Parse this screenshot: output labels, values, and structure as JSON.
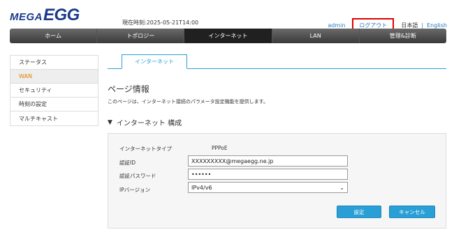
{
  "header": {
    "logo_mega": "MEGA",
    "logo_egg": "EGG",
    "current_time": "現在時刻:2025-05-21T14:00",
    "user": "admin",
    "logout": "ログアウト",
    "lang_ja": "日本語",
    "lang_sep": "|",
    "lang_en": "English"
  },
  "nav": {
    "items": [
      "ホーム",
      "トポロジー",
      "インターネット",
      "LAN",
      "管理&診断"
    ],
    "active_index": 2
  },
  "sidebar": {
    "items": [
      "ステータス",
      "WAN",
      "セキュリティ",
      "時刻の設定",
      "マルチキャスト"
    ],
    "active_index": 1
  },
  "tab": {
    "label": "インターネット"
  },
  "page": {
    "title": "ページ情報",
    "description": "このページは、インターネット接続のパラメータ設定機能を提供します。"
  },
  "section": {
    "title": "インターネット 構成"
  },
  "form": {
    "type_label": "インターネットタイプ",
    "type_value": "PPPoE",
    "auth_id_label": "認証ID",
    "auth_id_value": "XXXXXXXXX@megaegg.ne.jp",
    "auth_pw_label": "認証パスワード",
    "auth_pw_value": "••••••",
    "ip_version_label": "IPバージョン",
    "ip_version_value": "IPv4/v6"
  },
  "buttons": {
    "apply": "設定",
    "cancel": "キャンセル"
  },
  "colors": {
    "accent": "#2a9fd6",
    "logo": "#1a3a8c",
    "active_sidebar_text": "#e08000",
    "highlight_box": "#e00000"
  }
}
